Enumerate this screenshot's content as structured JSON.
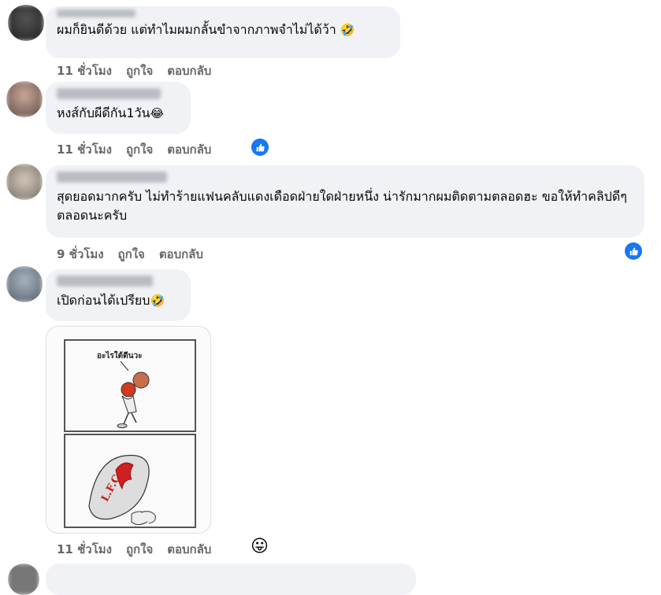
{
  "comments": [
    {
      "text": "ผมก็ยินดีด้วย แต่ทำไมผมกลั้นขำจากภาพจำไม่ได้ว้า",
      "emoji": "🤣",
      "time": "11 ชั่วโมง",
      "like": "ถูกใจ",
      "reply": "ตอบกลับ"
    },
    {
      "text": "หงส์กับผีดีกัน1วัน",
      "emoji": "😂",
      "time": "11 ชั่วโมง",
      "like": "ถูกใจ",
      "reply": "ตอบกลับ"
    },
    {
      "text": "สุดยอดมากครับ ไม่ทำร้ายแฟนคลับแดงเดือดฝ่ายใดฝ่ายหนึ่ง น่ารักมากผมติดตามตลอดฮะ ขอให้ทำคลิปดีๆตลอดนะครับ",
      "time": "9 ชั่วโมง",
      "like": "ถูกใจ",
      "reply": "ตอบกลับ"
    },
    {
      "text": "เปิดก่อนได้เปรียบ",
      "emoji": "🤣",
      "time": "11 ชั่วโมง",
      "like": "ถูกใจ",
      "reply": "ตอบกลับ",
      "image_caption": "อะไรใต้ตีนวะ",
      "image_shoe_text": "L.F.C"
    }
  ],
  "icons": {
    "like_badge": "thumbs-up-icon",
    "reaction": "grinning-face-icon",
    "reaction_glyph": "😛"
  },
  "colors": {
    "bubble": "#f0f2f5",
    "meta": "#65676b",
    "like_blue": "#1877f2"
  }
}
